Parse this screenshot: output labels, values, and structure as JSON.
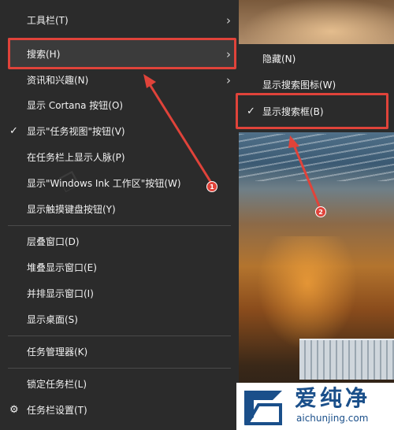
{
  "main_menu": {
    "items": [
      {
        "label": "工具栏(T)",
        "has_submenu": true
      },
      {
        "label": "搜索(H)",
        "has_submenu": true,
        "highlighted": true
      },
      {
        "label": "资讯和兴趣(N)",
        "has_submenu": true
      },
      {
        "label": "显示 Cortana 按钮(O)"
      },
      {
        "label": "显示\"任务视图\"按钮(V)",
        "checked": true
      },
      {
        "label": "在任务栏上显示人脉(P)"
      },
      {
        "label": "显示\"Windows Ink 工作区\"按钮(W)"
      },
      {
        "label": "显示触摸键盘按钮(Y)"
      },
      {
        "label": "层叠窗口(D)"
      },
      {
        "label": "堆叠显示窗口(E)"
      },
      {
        "label": "并排显示窗口(I)"
      },
      {
        "label": "显示桌面(S)"
      },
      {
        "label": "任务管理器(K)"
      },
      {
        "label": "锁定任务栏(L)"
      },
      {
        "label": "任务栏设置(T)",
        "icon": "gear-icon"
      }
    ]
  },
  "search_submenu": {
    "items": [
      {
        "label": "隐藏(N)"
      },
      {
        "label": "显示搜索图标(W)"
      },
      {
        "label": "显示搜索框(B)",
        "checked": true
      }
    ]
  },
  "annotations": {
    "badge_1": "1",
    "badge_2": "2",
    "color": "#e0433a"
  },
  "watermark": {
    "title": "爱纯净",
    "url": "aichunjing.com"
  },
  "icons": {
    "chevron": "chevron-right-icon",
    "check": "check-icon",
    "gear": "gear-icon"
  }
}
